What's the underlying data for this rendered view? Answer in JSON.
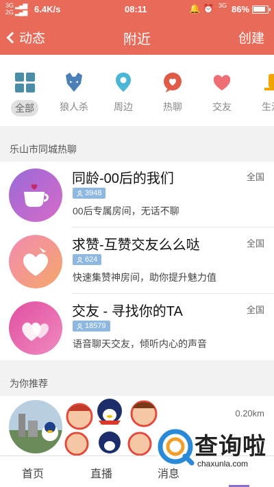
{
  "status_bar": {
    "network_top": "3G",
    "network_bottom": "2G",
    "speed": "6.4K/s",
    "time": "08:11",
    "network_right": "3G",
    "battery": "86%"
  },
  "header": {
    "back_label": "动态",
    "title": "附近",
    "create_label": "创建",
    "color": "#e86b5a"
  },
  "categories": [
    {
      "label": "全部",
      "icon": "grid-icon",
      "active": true
    },
    {
      "label": "狼人杀",
      "icon": "werewolf-icon"
    },
    {
      "label": "周边",
      "icon": "location-pin-icon"
    },
    {
      "label": "热聊",
      "icon": "chat-heart-icon"
    },
    {
      "label": "交友",
      "icon": "heart-icon"
    },
    {
      "label": "生活",
      "icon": "life-icon"
    }
  ],
  "hot_section": {
    "title": "乐山市同城热聊",
    "rooms": [
      {
        "name": "同龄-00后的我们",
        "count": "3948",
        "desc": "00后专属房间，无话不聊",
        "scope": "全国"
      },
      {
        "name": "求赞-互赞交友么么哒",
        "count": "624",
        "desc": "快速集赞神房间，助你提升魅力值",
        "scope": "全国"
      },
      {
        "name": "交友 - 寻找你的TA",
        "count": "18579",
        "desc": "语音聊天交友，倾听内心的声音",
        "scope": "全国"
      }
    ]
  },
  "recommend_section": {
    "title": "为你推荐",
    "distance": "0.20km"
  },
  "bottom_nav": {
    "items": [
      "首页",
      "直播",
      "消息"
    ]
  },
  "watermark": {
    "brand": "查询啦",
    "domain": "chaxunla.com"
  }
}
